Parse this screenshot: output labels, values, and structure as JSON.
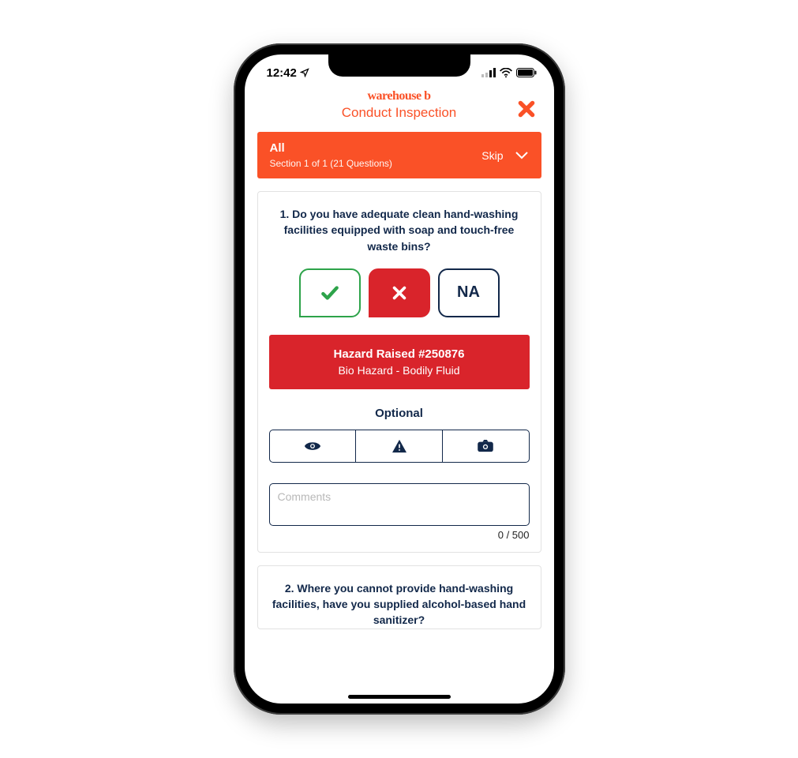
{
  "status": {
    "time": "12:42"
  },
  "header": {
    "brand": "warehouse b",
    "title": "Conduct Inspection"
  },
  "section": {
    "title": "All",
    "subtitle": "Section 1 of 1 (21 Questions)",
    "skip": "Skip"
  },
  "q1": {
    "text": "1. Do you have adequate clean hand-washing facilities equipped with soap and touch-free waste bins?",
    "na": "NA",
    "hazard_title": "Hazard Raised #250876",
    "hazard_sub": "Bio Hazard - Bodily Fluid",
    "optional": "Optional",
    "comments_placeholder": "Comments",
    "char_count": "0 / 500"
  },
  "q2": {
    "text": "2. Where you cannot provide hand-washing facilities, have you supplied alcohol-based hand sanitizer?"
  },
  "colors": {
    "accent": "#fa5127",
    "navy": "#12284a",
    "danger": "#d9242b",
    "green": "#2da34a"
  }
}
